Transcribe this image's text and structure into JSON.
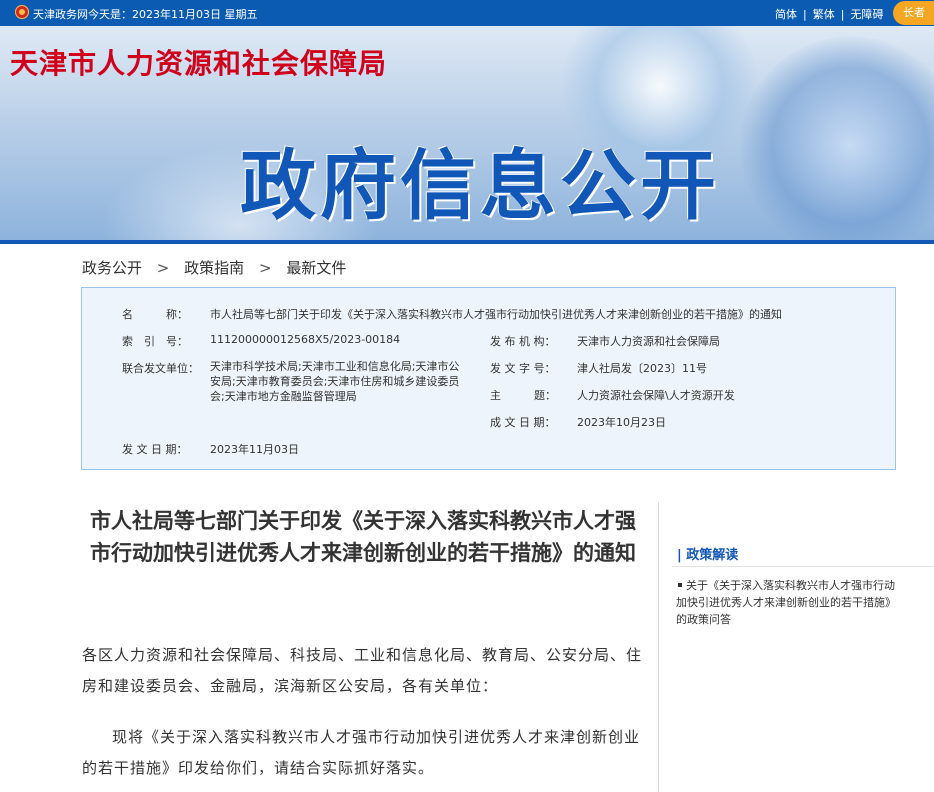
{
  "topbar": {
    "site_name": "天津政务网",
    "today": "今天是：2023年11月03日 星期五",
    "links": [
      "简体",
      "繁体",
      "无障碍"
    ],
    "separator": "|",
    "elder_mode": "长者"
  },
  "banner": {
    "agency": "天津市人力资源和社会保障局",
    "section": "政府信息公开"
  },
  "breadcrumb": {
    "items": [
      "政务公开",
      "政策指南",
      "最新文件"
    ],
    "arrow": ">"
  },
  "info": {
    "name_label": "名　　　称：",
    "name": "市人社局等七部门关于印发《关于深入落实科教兴市人才强市行动加快引进优秀人才来津创新创业的若干措施》的通知",
    "index_label": "索　引　号：",
    "index": "111200000012568X5/2023-00184",
    "issuer_label": "发 布 机 构：",
    "issuer": "天津市人力资源和社会保障局",
    "joint_label": "联合发文单位：",
    "joint": "天津市科学技术局;天津市工业和信息化局;天津市公安局;天津市教育委员会;天津市住房和城乡建设委员会;天津市地方金融监督管理局",
    "doc_no_label": "发 文 字 号：",
    "doc_no": "津人社局发〔2023〕11号",
    "subject_label": "主　　　题：",
    "subject": "人力资源社会保障\\人才资源开发",
    "date_made_label": "成 文 日 期：",
    "date_made": "2023年10月23日",
    "date_issued_label": "发 文 日 期：",
    "date_issued": "2023年11月03日"
  },
  "article": {
    "title": "市人社局等七部门关于印发《关于深入落实科教兴市人才强市行动加快引进优秀人才来津创新创业的若干措施》的通知",
    "para1": "各区人力资源和社会保障局、科技局、工业和信息化局、教育局、公安分局、住房和建设委员会、金融局，滨海新区公安局，各有关单位：",
    "para2": "现将《关于深入落实科教兴市人才强市行动加快引进优秀人才来津创新创业的若干措施》印发给你们，请结合实际抓好落实。"
  },
  "sidebar": {
    "title": "| 政策解读",
    "item": "关于《关于深入落实科教兴市人才强市行动加快引进优秀人才来津创新创业的若干措施》的政策问答"
  },
  "colors": {
    "topbar": "#0c5bb3",
    "brand_blue": "#1157b8",
    "agency_red": "#d0021b",
    "infobox_bg": "#eef4fb",
    "infobox_border": "#9cc2e5",
    "elder_orange": "#f5a623"
  }
}
